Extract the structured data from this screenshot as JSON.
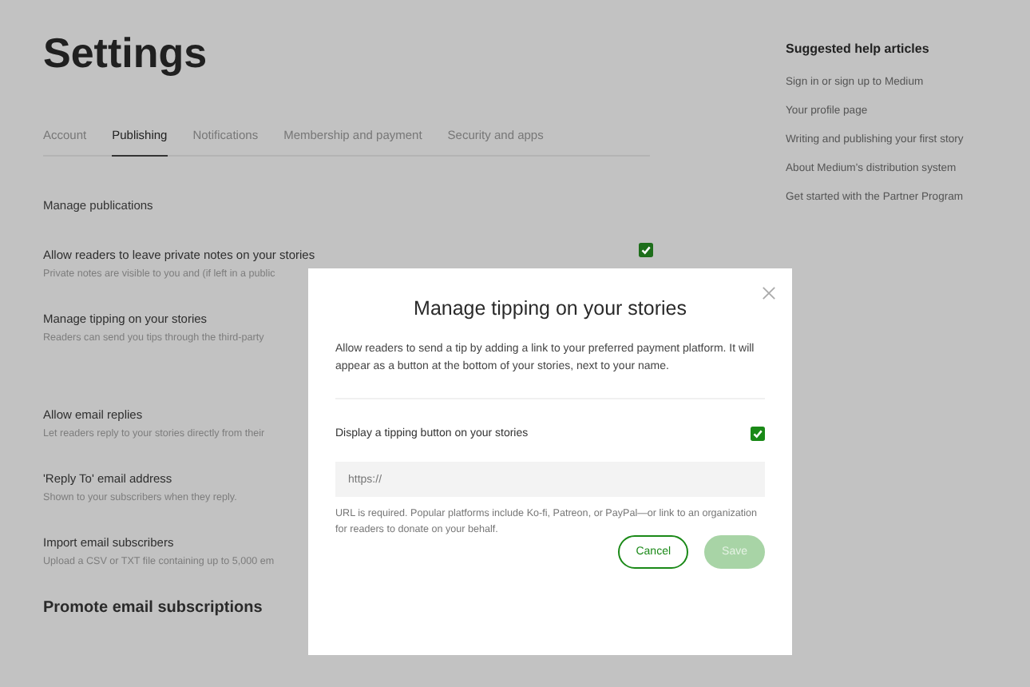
{
  "page": {
    "title": "Settings",
    "tabs": [
      {
        "label": "Account",
        "selected": false
      },
      {
        "label": "Publishing",
        "selected": true
      },
      {
        "label": "Notifications",
        "selected": false
      },
      {
        "label": "Membership and payment",
        "selected": false
      },
      {
        "label": "Security and apps",
        "selected": false
      }
    ],
    "section_link": "Manage publications",
    "settings": [
      {
        "title": "Allow readers to leave private notes on your stories",
        "description": "Private notes are visible to you and (if left in a public",
        "checked": true
      },
      {
        "title": "Manage tipping on your stories",
        "description": "Readers can send you tips through the third-party"
      },
      {
        "title": "Allow email replies",
        "description": "Let readers reply to your stories directly from their"
      },
      {
        "title": "'Reply To' email address",
        "description": "Shown to your subscribers when they reply."
      },
      {
        "title": "Import email subscribers",
        "description": "Upload a CSV or TXT file containing up to 5,000 em"
      }
    ],
    "section_heading": "Promote email subscriptions"
  },
  "sidebar": {
    "heading": "Suggested help articles",
    "items": [
      "Sign in or sign up to Medium",
      "Your profile page",
      "Writing and publishing your first story",
      "About Medium's distribution system",
      "Get started with the Partner Program"
    ]
  },
  "dialog": {
    "title": "Manage tipping on your stories",
    "description": "Allow readers to send a tip by adding a link to your preferred payment platform. It will appear as a button at the bottom of your stories, next to your name.",
    "option": {
      "label": "Display a tipping button on your stories",
      "checked": true
    },
    "url_field": {
      "placeholder": "https://"
    },
    "hint": "URL is required. Popular platforms include Ko-fi, Patreon, or PayPal—or link to an organization for readers to donate on your behalf.",
    "buttons": [
      {
        "label": "Cancel",
        "kind": "secondary",
        "disabled": false
      },
      {
        "label": "Save",
        "kind": "primary",
        "disabled": true
      }
    ]
  }
}
